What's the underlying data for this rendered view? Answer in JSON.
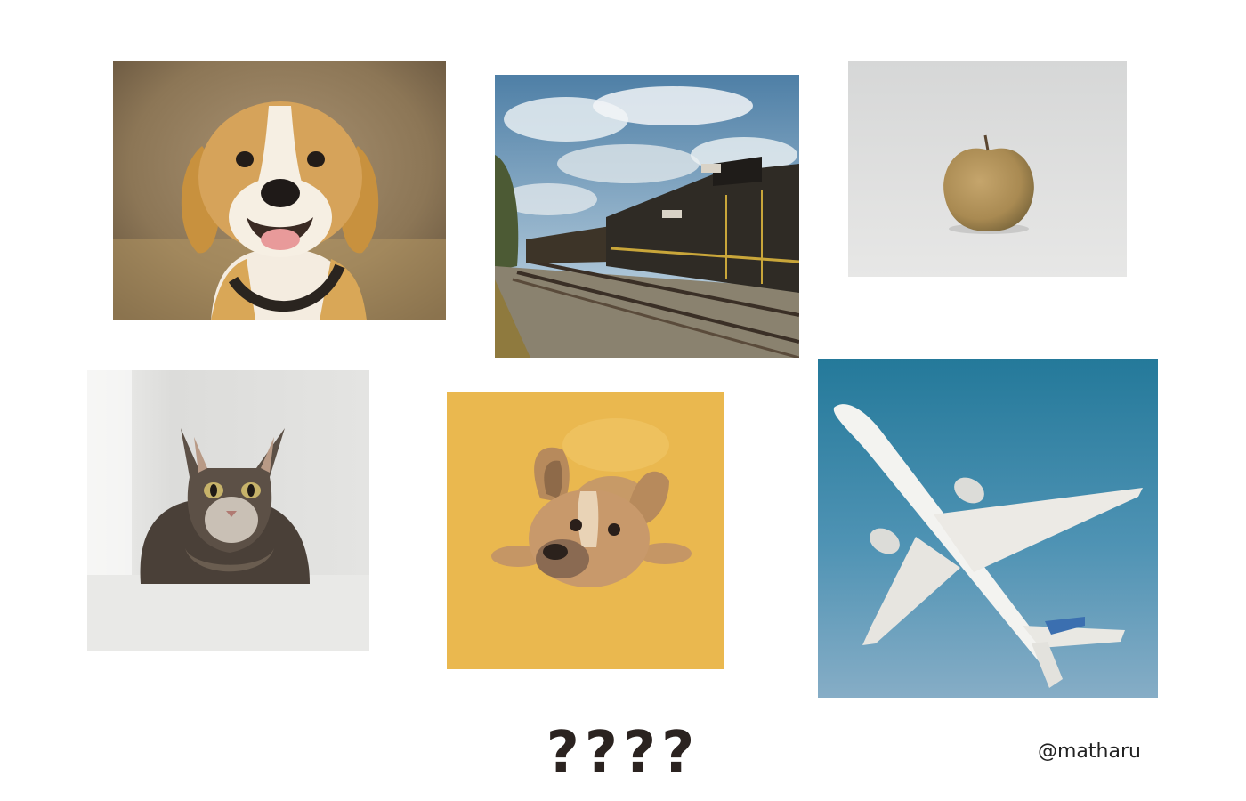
{
  "photos": [
    {
      "id": "beagle",
      "subject": "dog"
    },
    {
      "id": "train",
      "subject": "train"
    },
    {
      "id": "apple",
      "subject": "apple"
    },
    {
      "id": "cat",
      "subject": "cat"
    },
    {
      "id": "bulldog",
      "subject": "dog"
    },
    {
      "id": "airplane",
      "subject": "airplane"
    }
  ],
  "caption": "????",
  "credit": "@matharu",
  "colors": {
    "background": "#ffffff",
    "caption_text": "#2b2320",
    "bulldog_bg": "#eab84f",
    "airplane_sky": "#2a7a9c",
    "apple_bg": "#dcdcdc"
  }
}
